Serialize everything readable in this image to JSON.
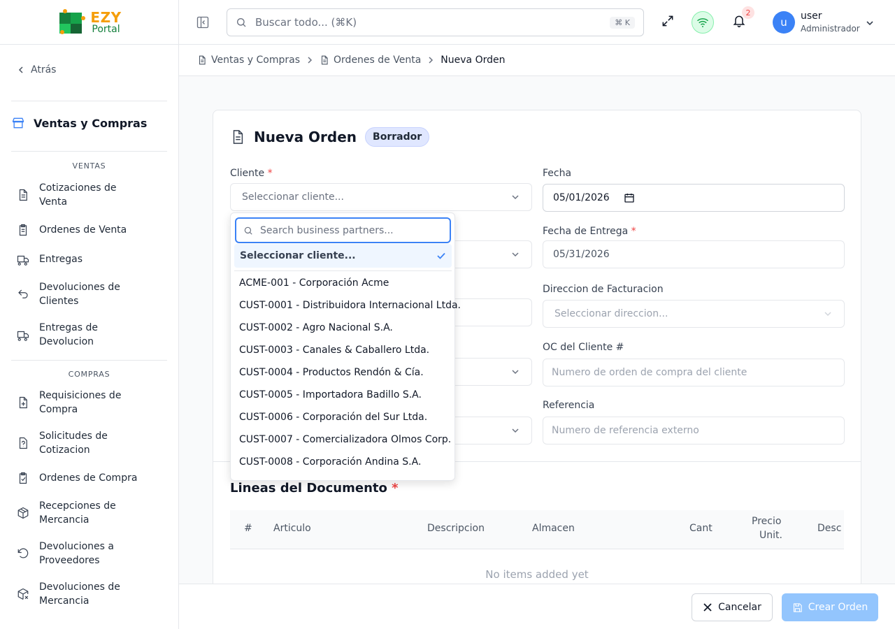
{
  "brand": {
    "name": "EZY",
    "sub": "Portal"
  },
  "sidebar": {
    "back_label": "Atrás",
    "module_title": "Ventas y Compras",
    "sections": [
      {
        "title": "VENTAS",
        "items": [
          {
            "line1": "Cotizaciones de",
            "line2": "Venta",
            "icon": "document-icon"
          },
          {
            "line1": "Ordenes de Venta",
            "line2": "",
            "icon": "clipboard-icon"
          },
          {
            "line1": "Entregas",
            "line2": "",
            "icon": "truck-icon"
          },
          {
            "line1": "Devoluciones de",
            "line2": "Clientes",
            "icon": "undo-icon"
          },
          {
            "line1": "Entregas de",
            "line2": "Devolucion",
            "icon": "truck-icon"
          }
        ]
      },
      {
        "title": "COMPRAS",
        "items": [
          {
            "line1": "Requisiciones de",
            "line2": "Compra",
            "icon": "file-plus-icon"
          },
          {
            "line1": "Solicitudes de",
            "line2": "Cotizacion",
            "icon": "file-question-icon"
          },
          {
            "line1": "Ordenes de Compra",
            "line2": "",
            "icon": "clipboard-check-icon"
          },
          {
            "line1": "Recepciones de",
            "line2": "Mercancia",
            "icon": "package-icon"
          },
          {
            "line1": "Devoluciones a",
            "line2": "Proveedores",
            "icon": "rotate-ccw-icon"
          },
          {
            "line1": "Devoluciones de",
            "line2": "Mercancia",
            "icon": "package-x-icon"
          }
        ]
      }
    ]
  },
  "header": {
    "search_placeholder": "Buscar todo... (⌘K)",
    "shortcut": "⌘ K",
    "notification_count": "2",
    "user": {
      "initial": "u",
      "name": "user",
      "role": "Administrador"
    }
  },
  "breadcrumb": [
    "Ventas y Compras",
    "Ordenes de Venta",
    "Nueva Orden"
  ],
  "form": {
    "title": "Nueva Orden",
    "status": "Borrador",
    "cliente_label": "Cliente",
    "cliente_placeholder": "Seleccionar cliente...",
    "fecha_label": "Fecha",
    "fecha_value": "05/01/2026",
    "entrega_label": "Fecha de Entrega",
    "entrega_value": "05/31/2026",
    "facturacion_label": "Direccion de Facturacion",
    "facturacion_placeholder": "Seleccionar direccion...",
    "oc_label": "OC del Cliente #",
    "oc_placeholder": "Numero de orden de compra del cliente",
    "ref_label": "Referencia",
    "ref_placeholder": "Numero de referencia externo"
  },
  "lines": {
    "title": "Lineas del Documento",
    "columns": [
      "#",
      "Articulo",
      "Descripcion",
      "Almacen",
      "Cant",
      "Precio",
      "Unit.",
      "Desc %"
    ],
    "empty": "No items added yet"
  },
  "dropdown": {
    "search_placeholder": "Search business partners...",
    "selected": "Seleccionar cliente...",
    "options": [
      "ACME-001 - Corporación Acme",
      "CUST-0001 - Distribuidora Internacional Ltda.",
      "CUST-0002 - Agro Nacional S.A.",
      "CUST-0003 - Canales & Caballero Ltda.",
      "CUST-0004 - Productos Rendón & Cía.",
      "CUST-0005 - Importadora Badillo S.A.",
      "CUST-0006 - Corporación del Sur Ltda.",
      "CUST-0007 - Comercializadora Olmos Corp.",
      "CUST-0008 - Corporación Andina S.A."
    ]
  },
  "footer": {
    "cancel": "Cancelar",
    "create": "Crear Orden"
  },
  "colors": {
    "accent": "#3b82f6",
    "brand_orange": "#f59e0b",
    "brand_green": "#15803d"
  }
}
